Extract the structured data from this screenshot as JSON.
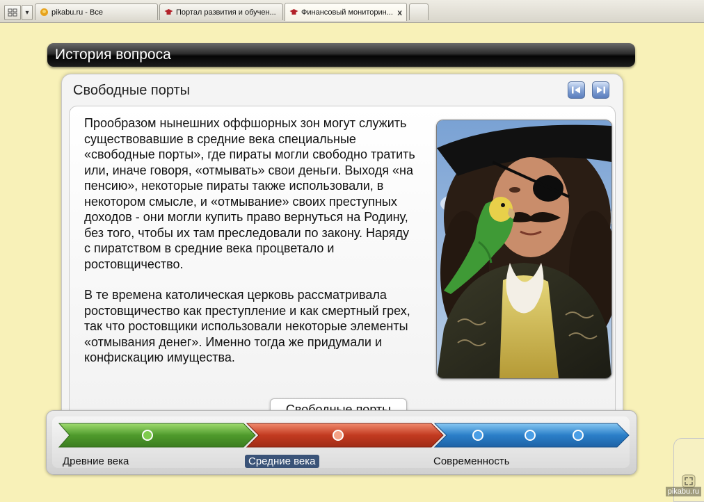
{
  "browser": {
    "tabs": [
      {
        "title": "pikabu.ru - Все",
        "icon": "pikabu-icon",
        "active": false
      },
      {
        "title": "Портал развития и обучен...",
        "icon": "graduation-cap-icon",
        "active": false
      },
      {
        "title": "Финансовый мониторин...",
        "icon": "graduation-cap-icon",
        "active": true
      }
    ],
    "close_glyph": "x"
  },
  "header": {
    "title": "История вопроса"
  },
  "slide": {
    "title": "Свободные порты",
    "prev_icon": "rewind-icon",
    "next_icon": "forward-icon",
    "paragraphs": [
      "Прообразом нынешних оффшорных зон могут служить существовавшие в средние века специальные «свободные порты», где пираты могли свободно тратить или, иначе говоря, «отмывать» свои деньги.  Выходя «на пенсию», некоторые пираты также использовали, в некотором смысле, и «отмывание» своих преступных доходов - они могли купить право вернуться на Родину, без того, чтобы их там преследовали по закону. Наряду с пиратством в средние века процветало и ростовщичество.",
      "В те времена католическая церковь рассматривала ростовщичество как преступление и как смертный грех, так что ростовщики использовали некоторые элементы «отмывания денег». Именно тогда же придумали и конфискацию имущества."
    ],
    "image": "pirate-with-parrot-photo"
  },
  "timeline": {
    "tooltip": "Свободные порты",
    "eras": [
      {
        "label": "Древние века",
        "color": "#4f9a2c",
        "selected": false
      },
      {
        "label": "Средние века",
        "color": "#c23a20",
        "selected": true
      },
      {
        "label": "Современность",
        "color": "#2b7fc8",
        "selected": false
      }
    ]
  },
  "watermark": "pikabu.ru",
  "colors": {
    "background": "#f8f1b8",
    "header": "#1a1a1a",
    "accent_blue": "#7f9ed2"
  }
}
